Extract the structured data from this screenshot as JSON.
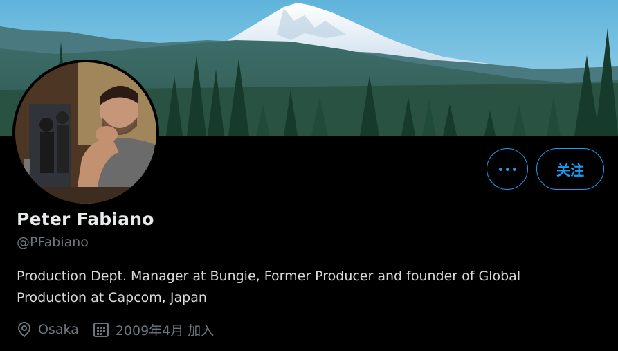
{
  "profile": {
    "name": "Peter Fabiano",
    "handle": "@PFabiano",
    "bio_line1": "Production Dept. Manager at Bungie, Former Producer and founder of Global",
    "bio_line2": "Production at Capcom, Japan",
    "location": "Osaka",
    "joined": "2009年4月 加入"
  },
  "actions": {
    "more_icon": "ellipsis-icon",
    "follow_label": "关注"
  },
  "colors": {
    "accent": "#1d9bf0",
    "background": "#000000",
    "secondary_text": "#6e767d",
    "primary_text": "#e7e9ea"
  },
  "icons": {
    "location": "location-pin-icon",
    "calendar": "calendar-icon"
  }
}
